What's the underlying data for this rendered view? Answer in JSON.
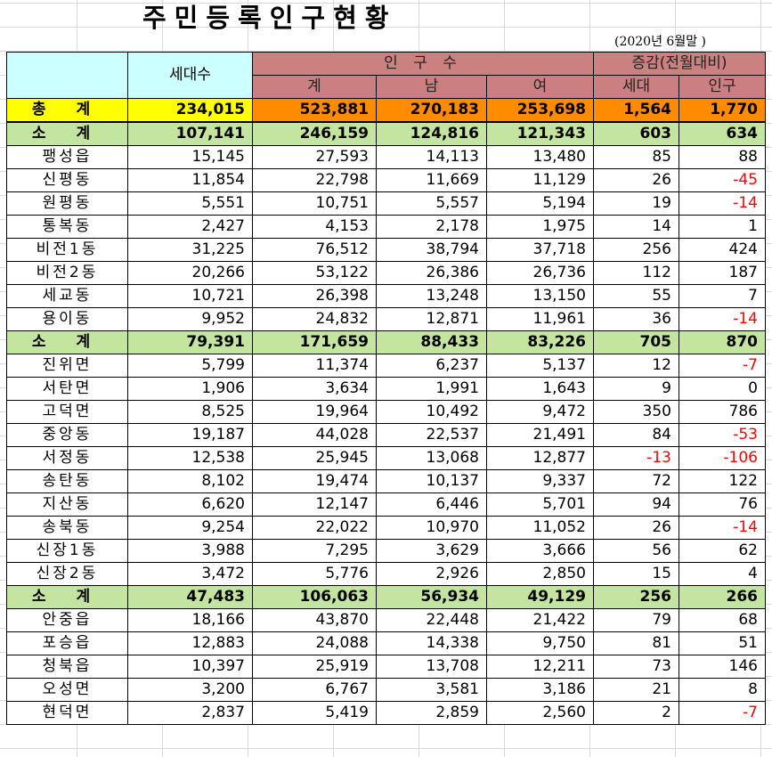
{
  "title": "주민등록인구현황",
  "date": "(2020년  6월말 )",
  "header": {
    "households": "세대수",
    "population": "인 구 수",
    "pop_total": "계",
    "pop_male": "남",
    "pop_female": "여",
    "change": "증감(전월대비)",
    "change_households": "세대",
    "change_population": "인구"
  },
  "total": {
    "label": "총 계",
    "households": "234,015",
    "pop_total": "523,881",
    "male": "270,183",
    "female": "253,698",
    "chg_households": "1,564",
    "chg_population": "1,770"
  },
  "groups": [
    {
      "subtotal": {
        "label": "소 계",
        "households": "107,141",
        "pop_total": "246,159",
        "male": "124,816",
        "female": "121,343",
        "chg_households": "603",
        "chg_population": "634"
      },
      "rows": [
        {
          "name": "팽성읍",
          "households": "15,145",
          "pop_total": "27,593",
          "male": "14,113",
          "female": "13,480",
          "chg_households": "85",
          "chg_population": "88"
        },
        {
          "name": "신평동",
          "households": "11,854",
          "pop_total": "22,798",
          "male": "11,669",
          "female": "11,129",
          "chg_households": "26",
          "chg_population": "-45"
        },
        {
          "name": "원평동",
          "households": "5,551",
          "pop_total": "10,751",
          "male": "5,557",
          "female": "5,194",
          "chg_households": "19",
          "chg_population": "-14"
        },
        {
          "name": "통복동",
          "households": "2,427",
          "pop_total": "4,153",
          "male": "2,178",
          "female": "1,975",
          "chg_households": "14",
          "chg_population": "1"
        },
        {
          "name": "비전1동",
          "households": "31,225",
          "pop_total": "76,512",
          "male": "38,794",
          "female": "37,718",
          "chg_households": "256",
          "chg_population": "424"
        },
        {
          "name": "비전2동",
          "households": "20,266",
          "pop_total": "53,122",
          "male": "26,386",
          "female": "26,736",
          "chg_households": "112",
          "chg_population": "187"
        },
        {
          "name": "세교동",
          "households": "10,721",
          "pop_total": "26,398",
          "male": "13,248",
          "female": "13,150",
          "chg_households": "55",
          "chg_population": "7"
        },
        {
          "name": "용이동",
          "households": "9,952",
          "pop_total": "24,832",
          "male": "12,871",
          "female": "11,961",
          "chg_households": "36",
          "chg_population": "-14"
        }
      ]
    },
    {
      "subtotal": {
        "label": "소 계",
        "households": "79,391",
        "pop_total": "171,659",
        "male": "88,433",
        "female": "83,226",
        "chg_households": "705",
        "chg_population": "870"
      },
      "rows": [
        {
          "name": "진위면",
          "households": "5,799",
          "pop_total": "11,374",
          "male": "6,237",
          "female": "5,137",
          "chg_households": "12",
          "chg_population": "-7"
        },
        {
          "name": "서탄면",
          "households": "1,906",
          "pop_total": "3,634",
          "male": "1,991",
          "female": "1,643",
          "chg_households": "9",
          "chg_population": "0"
        },
        {
          "name": "고덕면",
          "households": "8,525",
          "pop_total": "19,964",
          "male": "10,492",
          "female": "9,472",
          "chg_households": "350",
          "chg_population": "786"
        },
        {
          "name": "중앙동",
          "households": "19,187",
          "pop_total": "44,028",
          "male": "22,537",
          "female": "21,491",
          "chg_households": "84",
          "chg_population": "-53"
        },
        {
          "name": "서정동",
          "households": "12,538",
          "pop_total": "25,945",
          "male": "13,068",
          "female": "12,877",
          "chg_households": "-13",
          "chg_population": "-106"
        },
        {
          "name": "송탄동",
          "households": "8,102",
          "pop_total": "19,474",
          "male": "10,137",
          "female": "9,337",
          "chg_households": "72",
          "chg_population": "122"
        },
        {
          "name": "지산동",
          "households": "6,620",
          "pop_total": "12,147",
          "male": "6,446",
          "female": "5,701",
          "chg_households": "94",
          "chg_population": "76"
        },
        {
          "name": "송북동",
          "households": "9,254",
          "pop_total": "22,022",
          "male": "10,970",
          "female": "11,052",
          "chg_households": "26",
          "chg_population": "-14"
        },
        {
          "name": "신장1동",
          "households": "3,988",
          "pop_total": "7,295",
          "male": "3,629",
          "female": "3,666",
          "chg_households": "56",
          "chg_population": "62"
        },
        {
          "name": "신장2동",
          "households": "3,472",
          "pop_total": "5,776",
          "male": "2,926",
          "female": "2,850",
          "chg_households": "15",
          "chg_population": "4"
        }
      ]
    },
    {
      "subtotal": {
        "label": "소 계",
        "households": "47,483",
        "pop_total": "106,063",
        "male": "56,934",
        "female": "49,129",
        "chg_households": "256",
        "chg_population": "266"
      },
      "rows": [
        {
          "name": "안중읍",
          "households": "18,166",
          "pop_total": "43,870",
          "male": "22,448",
          "female": "21,422",
          "chg_households": "79",
          "chg_population": "68"
        },
        {
          "name": "포승읍",
          "households": "12,883",
          "pop_total": "24,088",
          "male": "14,338",
          "female": "9,750",
          "chg_households": "81",
          "chg_population": "51"
        },
        {
          "name": "청북읍",
          "households": "10,397",
          "pop_total": "25,919",
          "male": "13,708",
          "female": "12,211",
          "chg_households": "73",
          "chg_population": "146"
        },
        {
          "name": "오성면",
          "households": "3,200",
          "pop_total": "6,767",
          "male": "3,581",
          "female": "3,186",
          "chg_households": "21",
          "chg_population": "8"
        },
        {
          "name": "현덕면",
          "households": "2,837",
          "pop_total": "5,419",
          "male": "2,859",
          "female": "2,560",
          "chg_households": "2",
          "chg_population": "-7"
        }
      ]
    }
  ],
  "colors": {
    "header_cyan": "#ccffff",
    "header_rose": "#cc8080",
    "total_yellow": "#ffff00",
    "total_orange": "#ff8c00",
    "subtotal_green": "#c4e59f",
    "negative_red": "#ff0000"
  }
}
